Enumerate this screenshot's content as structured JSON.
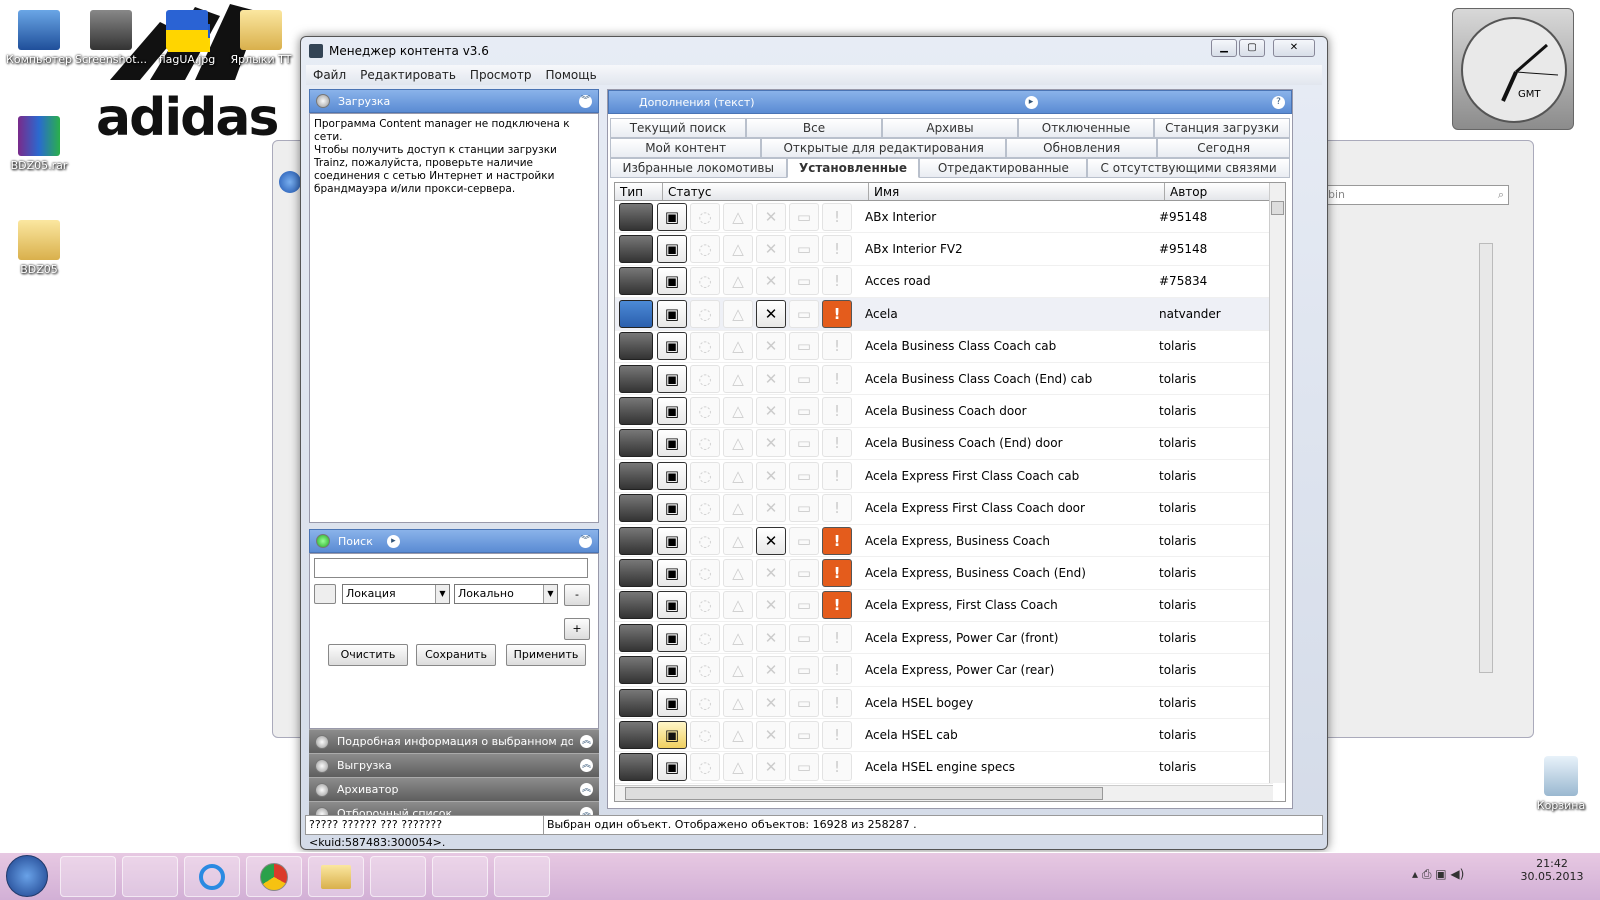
{
  "desktop": {
    "icons": [
      {
        "label": "Компьютер"
      },
      {
        "label": "Screenshot..."
      },
      {
        "label": "flagUA.jpg"
      },
      {
        "label": "Ярлыки ТТ"
      },
      {
        "label": "BDZ05.rar"
      },
      {
        "label": "BDZ05"
      },
      {
        "label": "Корзина"
      }
    ],
    "brand": "adidas",
    "clock_label": "GMT"
  },
  "window": {
    "title": "Менеджер контента v3.6",
    "menu": [
      "Файл",
      "Редактировать",
      "Просмотр",
      "Помощь"
    ]
  },
  "left_panel": {
    "download": {
      "header": "Загрузка",
      "message": "Программа Content manager не подключена к сети.\nЧтобы получить доступ к станции загрузки Trainz, пожалуйста, проверьте наличие соединения с сетью Интернет и настройки брандмауэра и/или прокси-сервера."
    },
    "search": {
      "header": "Поиск",
      "input_value": "",
      "location_select": "Локация",
      "scope_select": "Локально",
      "minus": "-",
      "plus": "+",
      "clear": "Очистить",
      "save": "Сохранить",
      "apply": "Применить"
    },
    "collapsed_panels": [
      "Подробная информация о выбранном дополнении",
      "Выгрузка",
      "Архиватор",
      "Отборочный список"
    ]
  },
  "right_panel": {
    "header": "Дополнения (текст)",
    "help": "?",
    "tabs_row1": [
      "Текущий поиск",
      "Все",
      "Архивы",
      "Отключенные",
      "Станция загрузки"
    ],
    "tabs_row2": [
      "Мой контент",
      "Открытые для редактирования",
      "Обновления",
      "Сегодня"
    ],
    "tabs_row3": [
      "Избранные локомотивы",
      "Установленные",
      "Отредактированные",
      "С отсутствующими связями"
    ],
    "active_tab": "Установленные",
    "columns": {
      "type": "Тип",
      "status": "Статус",
      "name": "Имя",
      "author": "Автор"
    },
    "rows": [
      {
        "name": "ABx Interior",
        "author": "#95148"
      },
      {
        "name": "ABx Interior FV2",
        "author": "#95148"
      },
      {
        "name": "Acces road",
        "author": "#75834"
      },
      {
        "name": "Acela",
        "author": "natvander"
      },
      {
        "name": "Acela Business Class Coach cab",
        "author": "tolaris"
      },
      {
        "name": "Acela Business Class Coach (End) cab",
        "author": "tolaris"
      },
      {
        "name": "Acela Business Coach door",
        "author": "tolaris"
      },
      {
        "name": "Acela Business Coach (End) door",
        "author": "tolaris"
      },
      {
        "name": "Acela Express First Class Coach cab",
        "author": "tolaris"
      },
      {
        "name": "Acela Express First Class Coach door",
        "author": "tolaris"
      },
      {
        "name": "Acela Express, Business Coach",
        "author": "tolaris"
      },
      {
        "name": "Acela Express, Business Coach (End)",
        "author": "tolaris"
      },
      {
        "name": "Acela Express, First Class Coach",
        "author": "tolaris"
      },
      {
        "name": "Acela Express, Power Car (front)",
        "author": "tolaris"
      },
      {
        "name": "Acela Express, Power Car (rear)",
        "author": "tolaris"
      },
      {
        "name": "Acela HSEL bogey",
        "author": "tolaris"
      },
      {
        "name": "Acela HSEL cab",
        "author": "tolaris"
      },
      {
        "name": "Acela HSEL engine specs",
        "author": "tolaris"
      }
    ]
  },
  "statusbar": {
    "kuid": "????? ?????? ??? ??????? <kuid:587483:300054>.",
    "info": "Выбран один объект. Отображено объектов: 16928 из 258287 ."
  },
  "explorer": {
    "search_placeholder": "bin"
  },
  "taskbar": {
    "time": "21:42",
    "date": "30.05.2013"
  }
}
